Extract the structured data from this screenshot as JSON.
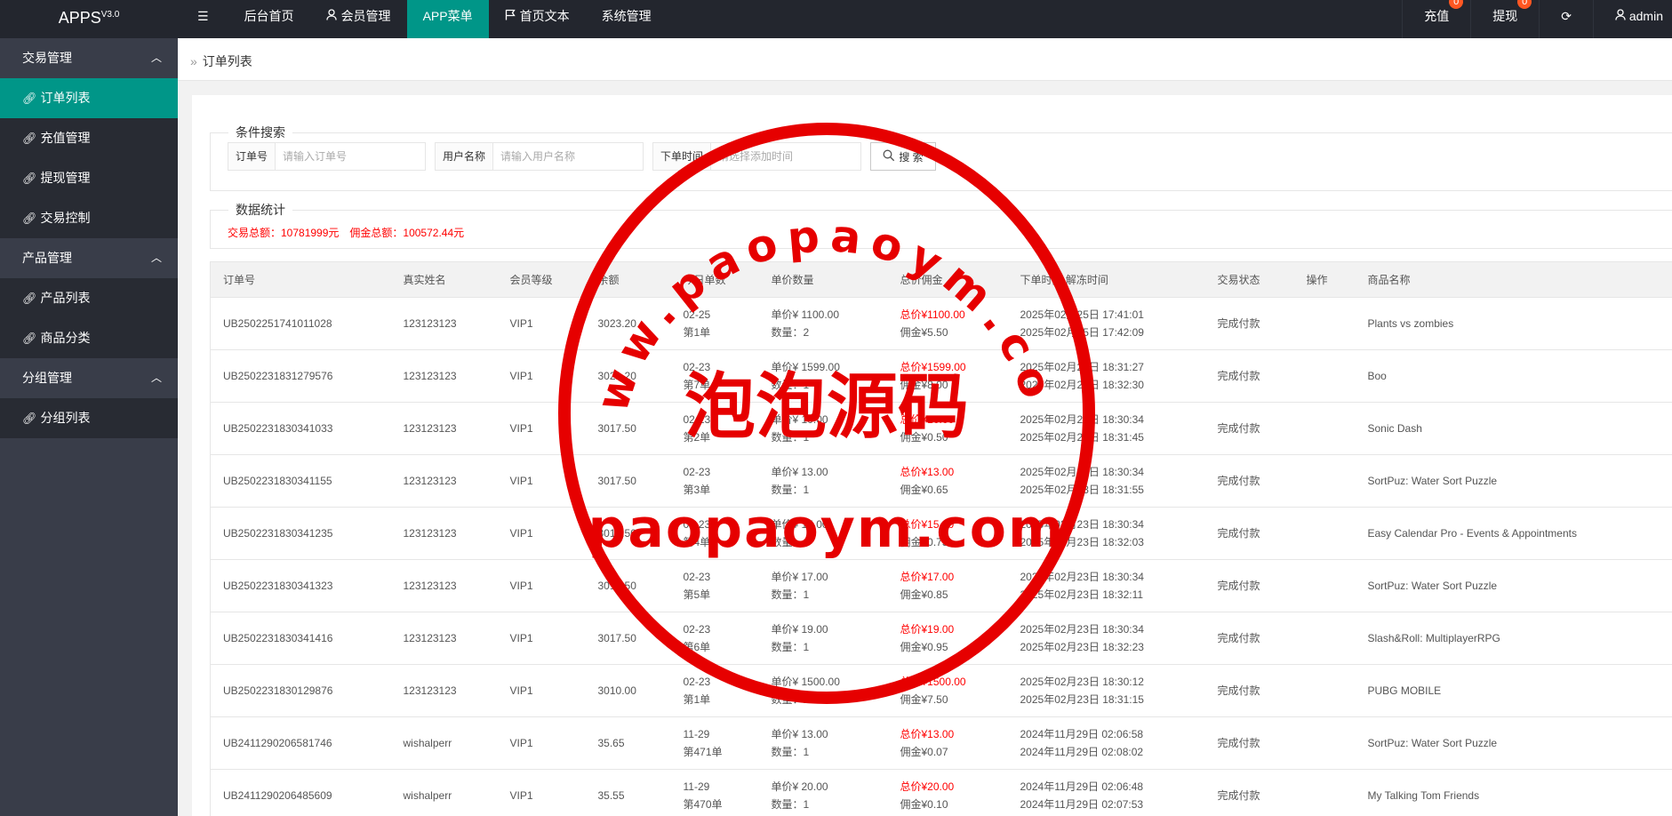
{
  "header": {
    "logo": "APPS",
    "version": "V3.0",
    "nav": [
      {
        "label": "后台首页",
        "icon": ""
      },
      {
        "label": "会员管理",
        "icon": "user-icon"
      },
      {
        "label": "APP菜单",
        "icon": "",
        "active": true
      },
      {
        "label": "首页文本",
        "icon": "flag-icon"
      },
      {
        "label": "系统管理",
        "icon": ""
      }
    ],
    "right": {
      "recharge": "充值",
      "recharge_badge": "0",
      "withdraw": "提现",
      "withdraw_badge": "0",
      "user": "admin"
    }
  },
  "sidebar": {
    "groups": [
      {
        "title": "交易管理",
        "items": [
          "订单列表",
          "充值管理",
          "提现管理",
          "交易控制"
        ]
      },
      {
        "title": "产品管理",
        "items": [
          "产品列表",
          "商品分类"
        ]
      },
      {
        "title": "分组管理",
        "items": [
          "分组列表"
        ]
      }
    ],
    "active": "订单列表"
  },
  "breadcrumb": "订单列表",
  "search": {
    "legend": "条件搜索",
    "order_label": "订单号",
    "order_placeholder": "请输入订单号",
    "user_label": "用户名称",
    "user_placeholder": "请输入用户名称",
    "time_label": "下单时间",
    "time_placeholder": "请选择添加时间",
    "button": "搜 索"
  },
  "stats": {
    "legend": "数据统计",
    "total_trade": "交易总额：10781999元",
    "total_commission": "佣金总额：100572.44元"
  },
  "table": {
    "headers": [
      "订单号",
      "真实姓名",
      "会员等级",
      "余额",
      "今日单数",
      "单价数量",
      "总价佣金",
      "下单时间 解冻时间",
      "交易状态",
      "操作",
      "商品名称"
    ],
    "rows": [
      {
        "id": "UB2502251741011028",
        "name": "123123123",
        "level": "VIP1",
        "balance": "3023.20",
        "date": "02-25",
        "count": "第1单",
        "price": "单价¥  1100.00",
        "qty": "数量：2",
        "total": "总价¥1100.00",
        "commission": "佣金¥5.50",
        "ordered": "2025年02月25日 17:41:01",
        "unfrozen": "2025年02月25日 17:42:09",
        "status": "完成付款",
        "product": "Plants vs zombies"
      },
      {
        "id": "UB2502231831279576",
        "name": "123123123",
        "level": "VIP1",
        "balance": "3021.20",
        "date": "02-23",
        "count": "第7单",
        "price": "单价¥  1599.00",
        "qty": "数量：1",
        "total": "总价¥1599.00",
        "commission": "佣金¥8.00",
        "ordered": "2025年02月23日 18:31:27",
        "unfrozen": "2025年02月23日 18:32:30",
        "status": "完成付款",
        "product": "Boo"
      },
      {
        "id": "UB2502231830341033",
        "name": "123123123",
        "level": "VIP1",
        "balance": "3017.50",
        "date": "02-23",
        "count": "第2单",
        "price": "单价¥  10.00",
        "qty": "数量：1",
        "total": "总价¥10.00",
        "commission": "佣金¥0.50",
        "ordered": "2025年02月23日 18:30:34",
        "unfrozen": "2025年02月23日 18:31:45",
        "status": "完成付款",
        "product": "Sonic Dash"
      },
      {
        "id": "UB2502231830341155",
        "name": "123123123",
        "level": "VIP1",
        "balance": "3017.50",
        "date": "02-23",
        "count": "第3单",
        "price": "单价¥  13.00",
        "qty": "数量：1",
        "total": "总价¥13.00",
        "commission": "佣金¥0.65",
        "ordered": "2025年02月23日 18:30:34",
        "unfrozen": "2025年02月23日 18:31:55",
        "status": "完成付款",
        "product": "SortPuz: Water Sort Puzzle"
      },
      {
        "id": "UB2502231830341235",
        "name": "123123123",
        "level": "VIP1",
        "balance": "3017.50",
        "date": "02-23",
        "count": "第4单",
        "price": "单价¥  15.00",
        "qty": "数量：1",
        "total": "总价¥15.00",
        "commission": "佣金¥0.75",
        "ordered": "2025年02月23日 18:30:34",
        "unfrozen": "2025年02月23日 18:32:03",
        "status": "完成付款",
        "product": "Easy Calendar Pro - Events & Appointments"
      },
      {
        "id": "UB2502231830341323",
        "name": "123123123",
        "level": "VIP1",
        "balance": "3017.50",
        "date": "02-23",
        "count": "第5单",
        "price": "单价¥  17.00",
        "qty": "数量：1",
        "total": "总价¥17.00",
        "commission": "佣金¥0.85",
        "ordered": "2025年02月23日 18:30:34",
        "unfrozen": "2025年02月23日 18:32:11",
        "status": "完成付款",
        "product": "SortPuz: Water Sort Puzzle"
      },
      {
        "id": "UB2502231830341416",
        "name": "123123123",
        "level": "VIP1",
        "balance": "3017.50",
        "date": "02-23",
        "count": "第6单",
        "price": "单价¥  19.00",
        "qty": "数量：1",
        "total": "总价¥19.00",
        "commission": "佣金¥0.95",
        "ordered": "2025年02月23日 18:30:34",
        "unfrozen": "2025年02月23日 18:32:23",
        "status": "完成付款",
        "product": "Slash&Roll: MultiplayerRPG"
      },
      {
        "id": "UB2502231830129876",
        "name": "123123123",
        "level": "VIP1",
        "balance": "3010.00",
        "date": "02-23",
        "count": "第1单",
        "price": "单价¥  1500.00",
        "qty": "数量：1",
        "total": "总价¥1500.00",
        "commission": "佣金¥7.50",
        "ordered": "2025年02月23日 18:30:12",
        "unfrozen": "2025年02月23日 18:31:15",
        "status": "完成付款",
        "product": "PUBG MOBILE"
      },
      {
        "id": "UB2411290206581746",
        "name": "wishalperr",
        "level": "VIP1",
        "balance": "35.65",
        "date": "11-29",
        "count": "第471单",
        "price": "单价¥  13.00",
        "qty": "数量：1",
        "total": "总价¥13.00",
        "commission": "佣金¥0.07",
        "ordered": "2024年11月29日 02:06:58",
        "unfrozen": "2024年11月29日 02:08:02",
        "status": "完成付款",
        "product": "SortPuz: Water Sort Puzzle"
      },
      {
        "id": "UB2411290206485609",
        "name": "wishalperr",
        "level": "VIP1",
        "balance": "35.55",
        "date": "11-29",
        "count": "第470单",
        "price": "单价¥  20.00",
        "qty": "数量：1",
        "total": "总价¥20.00",
        "commission": "佣金¥0.10",
        "ordered": "2024年11月29日 02:06:48",
        "unfrozen": "2024年11月29日 02:07:53",
        "status": "完成付款",
        "product": "My Talking Tom Friends"
      }
    ]
  },
  "watermark": {
    "arc_text": "www.paopaoym.com",
    "center_text": "泡泡源码",
    "bottom_text": "paopaoym.com",
    "color": "#e60000"
  }
}
